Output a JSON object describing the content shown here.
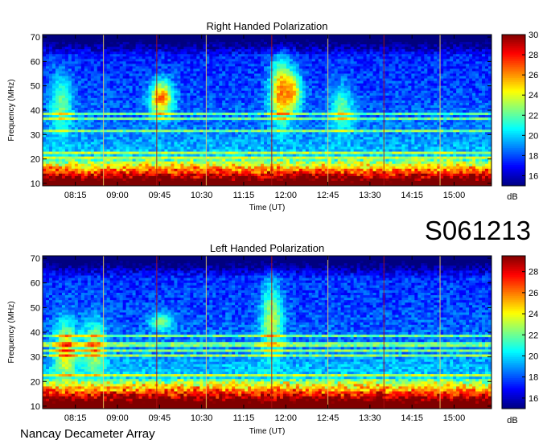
{
  "figure": {
    "observation_id": "S061213",
    "instrument": "Nancay Decameter Array"
  },
  "chart_data": [
    {
      "type": "heatmap",
      "title": "Right Handed Polarization",
      "xlabel": "Time (UT)",
      "ylabel": "Frequency (MHz)",
      "x_ticks": [
        "08:15",
        "09:00",
        "09:45",
        "10:30",
        "11:15",
        "12:00",
        "12:45",
        "13:30",
        "14:15",
        "15:00"
      ],
      "x_range": [
        "07:40",
        "15:40"
      ],
      "y_ticks": [
        10,
        20,
        30,
        40,
        50,
        60,
        70
      ],
      "ylim": [
        9,
        71
      ],
      "colorbar": {
        "label": "dB",
        "ticks": [
          16,
          18,
          20,
          22,
          24,
          26,
          28,
          30
        ],
        "range": [
          15,
          30
        ],
        "colormap": "jet"
      },
      "features": {
        "strong_emission_band_mhz": [
          10,
          20
        ],
        "bursts": [
          {
            "time": "09:47",
            "freq_mhz": [
              38,
              52
            ],
            "peak_db": 28
          },
          {
            "time": "11:55",
            "freq_mhz": [
              35,
              60
            ],
            "peak_db": 27
          },
          {
            "time": "12:05",
            "freq_mhz": [
              40,
              55
            ],
            "peak_db": 27
          },
          {
            "time": "08:00",
            "freq_mhz": [
              30,
              55
            ],
            "peak_db": 23
          },
          {
            "time": "13:00",
            "freq_mhz": [
              30,
              50
            ],
            "peak_db": 23
          }
        ],
        "vertical_line_times": [
          "08:45",
          "09:42",
          "10:35",
          "11:45",
          "12:45",
          "13:45",
          "14:45"
        ]
      }
    },
    {
      "type": "heatmap",
      "title": "Left Handed Polarization",
      "xlabel": "Time (UT)",
      "ylabel": "Frequency (MHz)",
      "x_ticks": [
        "08:15",
        "09:00",
        "09:45",
        "10:30",
        "11:15",
        "12:00",
        "12:45",
        "13:30",
        "14:15",
        "15:00"
      ],
      "x_range": [
        "07:40",
        "15:40"
      ],
      "y_ticks": [
        10,
        20,
        30,
        40,
        50,
        60,
        70
      ],
      "ylim": [
        9,
        71
      ],
      "colorbar": {
        "label": "dB",
        "ticks": [
          16,
          18,
          20,
          22,
          24,
          26,
          28
        ],
        "range": [
          15,
          29.5
        ],
        "colormap": "jet"
      },
      "features": {
        "strong_emission_band_mhz": [
          10,
          21
        ],
        "bursts": [
          {
            "time": "08:05",
            "freq_mhz": [
              20,
              45
            ],
            "peak_db": 25
          },
          {
            "time": "08:35",
            "freq_mhz": [
              22,
              45
            ],
            "peak_db": 24
          },
          {
            "time": "11:45",
            "freq_mhz": [
              30,
              60
            ],
            "peak_db": 24
          },
          {
            "time": "09:47",
            "freq_mhz": [
              40,
              48
            ],
            "peak_db": 23
          }
        ],
        "vertical_line_times": [
          "08:45",
          "09:42",
          "10:35",
          "11:45",
          "12:45",
          "13:45",
          "14:45"
        ]
      }
    }
  ]
}
